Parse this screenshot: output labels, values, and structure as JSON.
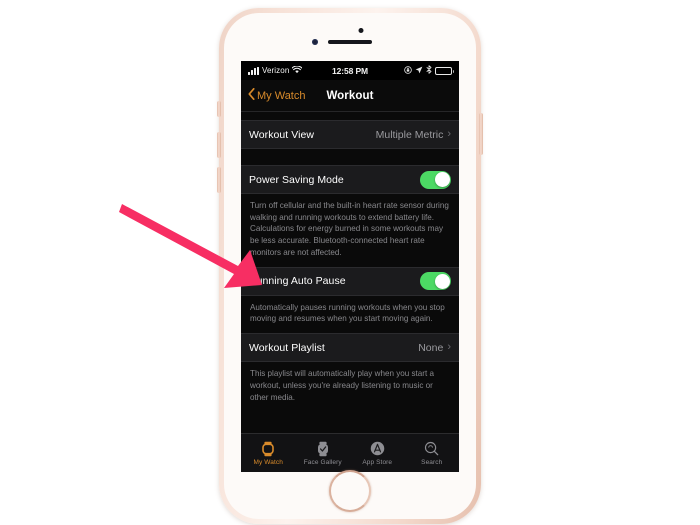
{
  "device": {
    "name": "iphone-rose-gold",
    "frame_color": "#f3d8cb"
  },
  "status_bar": {
    "carrier": "Verizon",
    "signal_icon": "cellular-signal-icon",
    "wifi_icon": "wifi-icon",
    "time": "12:58 PM",
    "rotation_lock_icon": "rotation-lock-icon",
    "location_icon": "location-arrow-icon",
    "bluetooth_icon": "bluetooth-icon",
    "battery_icon": "battery-icon"
  },
  "nav": {
    "back_label": "My Watch",
    "back_icon": "chevron-left-icon",
    "title": "Workout",
    "tint_color": "#d98b2b"
  },
  "settings": {
    "workout_view": {
      "label": "Workout View",
      "value": "Multiple Metric",
      "chevron": "›"
    },
    "power_saving": {
      "label": "Power Saving Mode",
      "toggle_on": true,
      "footnote": "Turn off cellular and the built-in heart rate sensor during walking and running workouts to extend battery life. Calculations for energy burned in some workouts may be less accurate. Bluetooth-connected heart rate monitors are not affected."
    },
    "running_auto_pause": {
      "label": "Running Auto Pause",
      "toggle_on": true,
      "footnote": "Automatically pauses running workouts when you stop moving and resumes when you start moving again."
    },
    "workout_playlist": {
      "label": "Workout Playlist",
      "value": "None",
      "chevron": "›",
      "footnote": "This playlist will automatically play when you start a workout, unless you're already listening to music or other media."
    },
    "toggle_on_color": "#4cd964"
  },
  "tab_bar": {
    "items": [
      {
        "label": "My Watch",
        "icon": "watch-icon",
        "active": true
      },
      {
        "label": "Face Gallery",
        "icon": "watch-face-icon",
        "active": false
      },
      {
        "label": "App Store",
        "icon": "app-store-icon",
        "active": false
      },
      {
        "label": "Search",
        "icon": "search-icon",
        "active": false
      }
    ],
    "active_color": "#d98b2b",
    "inactive_color": "#8e8e93"
  },
  "annotation": {
    "arrow_icon": "pointer-arrow-icon",
    "color": "#f72e63",
    "points_to": "Running Auto Pause"
  }
}
